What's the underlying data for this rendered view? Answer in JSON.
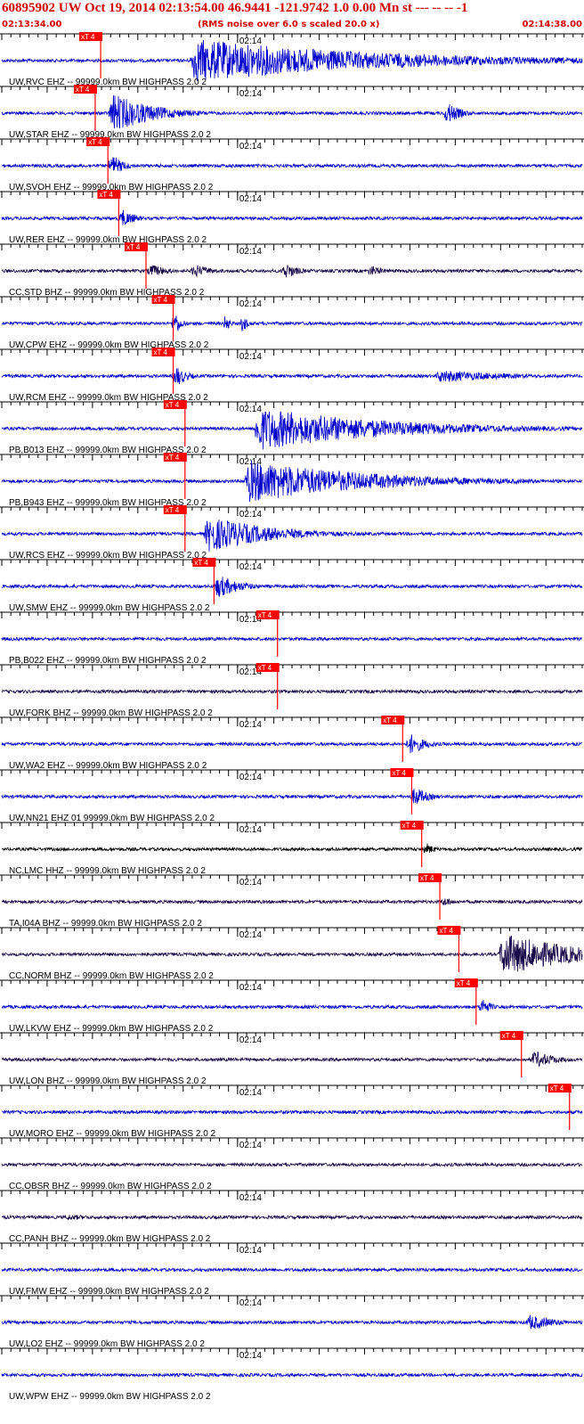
{
  "header": {
    "title": "60895902 UW Oct 19, 2014 02:13:54.00   46.9441 -121.9742  1.0 0.00 Mn st --- -- --  -1",
    "start_time": "02:13:34.00",
    "note": "(RMS noise over 6.0 s scaled 20.0 x)",
    "end_time": "02:14:38.00"
  },
  "colors": {
    "header_text": "#d40000",
    "trace_blue": "#0000cc",
    "trace_dark": "#1a0a4a",
    "trace_black": "#000000",
    "pick": "#ff0000",
    "axis": "#000000"
  },
  "chart_data": {
    "type": "seismogram",
    "time_range": [
      "02:13:34.00",
      "02:14:38.00"
    ],
    "minute_label": "02:14",
    "pick_label": "xT 4",
    "traces": [
      {
        "label": "UW,RVC EHZ -- 99999.0km BW  HIGHPASS  2.0  2",
        "color": "blue",
        "pick_s": 10.9,
        "events": [
          {
            "t": 21.0,
            "amp": 1.0,
            "dur": 20.0
          }
        ]
      },
      {
        "label": "UW,STAR EHZ -- 99999.0km BW  HIGHPASS  2.0  2",
        "color": "blue",
        "pick_s": 10.3,
        "events": [
          {
            "t": 12.0,
            "amp": 0.95,
            "dur": 4.5
          },
          {
            "t": 48.9,
            "amp": 0.6,
            "dur": 1.5
          }
        ]
      },
      {
        "label": "UW,SVOH EHZ -- 99999.0km BW  HIGHPASS  2.0  2",
        "color": "blue",
        "pick_s": 11.7,
        "events": [
          {
            "t": 11.9,
            "amp": 0.6,
            "dur": 1.4
          }
        ]
      },
      {
        "label": "UW,RER EHZ -- 99999.0km BW  HIGHPASS  2.0  2",
        "color": "blue",
        "pick_s": 12.9,
        "events": [
          {
            "t": 13.0,
            "amp": 0.5,
            "dur": 1.5
          }
        ]
      },
      {
        "label": "CC,STD BHZ -- 99999.0km BW  HIGHPASS  2.0  2",
        "color": "dark",
        "pick_s": 15.9,
        "events": [
          {
            "t": 16.2,
            "amp": 0.35,
            "dur": 2.0
          },
          {
            "t": 21.0,
            "amp": 0.35,
            "dur": 2.0
          },
          {
            "t": 31.0,
            "amp": 0.45,
            "dur": 1.5
          },
          {
            "t": 40.5,
            "amp": 0.3,
            "dur": 1.5
          }
        ]
      },
      {
        "label": "UW,CPW EHZ -- 99999.0km BW  HIGHPASS  2.0  2",
        "color": "blue",
        "pick_s": 18.9,
        "events": [
          {
            "t": 18.9,
            "amp": 0.75,
            "dur": 0.7
          },
          {
            "t": 24.6,
            "amp": 0.7,
            "dur": 0.4
          },
          {
            "t": 26.5,
            "amp": 0.7,
            "dur": 0.4
          }
        ]
      },
      {
        "label": "UW,RCM EHZ -- 99999.0km BW  HIGHPASS  2.0  2",
        "color": "blue",
        "pick_s": 18.9,
        "events": [
          {
            "t": 19.0,
            "amp": 0.6,
            "dur": 1.2
          },
          {
            "t": 48.0,
            "amp": 0.3,
            "dur": 8.0
          }
        ]
      },
      {
        "label": "PB,B013 EHZ -- 99999.0km BW  HIGHPASS  2.0  2",
        "color": "blue",
        "pick_s": 20.2,
        "events": [
          {
            "t": 28.0,
            "amp": 1.0,
            "dur": 14.0
          }
        ]
      },
      {
        "label": "PB,B943 EHZ -- 99999.0km BW  HIGHPASS  2.0  2",
        "color": "blue",
        "pick_s": 20.2,
        "events": [
          {
            "t": 27.0,
            "amp": 1.0,
            "dur": 13.0
          }
        ]
      },
      {
        "label": "UW,RCS EHZ -- 99999.0km BW  HIGHPASS  2.0  2",
        "color": "blue",
        "pick_s": 20.2,
        "events": [
          {
            "t": 22.5,
            "amp": 0.85,
            "dur": 7.0
          }
        ]
      },
      {
        "label": "UW,SMW EHZ -- 99999.0km BW  HIGHPASS  2.0  2",
        "color": "blue",
        "pick_s": 23.4,
        "events": [
          {
            "t": 23.6,
            "amp": 0.6,
            "dur": 2.5
          }
        ]
      },
      {
        "label": "PB,B022 EHZ -- 99999.0km BW  HIGHPASS  2.0  2",
        "color": "blue",
        "pick_s": 30.4,
        "events": []
      },
      {
        "label": "UW,FORK BHZ -- 99999.0km BW  HIGHPASS  2.0  2",
        "color": "dark",
        "pick_s": 30.4,
        "events": []
      },
      {
        "label": "UW,WA2 EHZ -- 99999.0km BW  HIGHPASS  2.0  2",
        "color": "blue",
        "pick_s": 44.2,
        "events": [
          {
            "t": 44.8,
            "amp": 0.55,
            "dur": 1.8
          }
        ]
      },
      {
        "label": "UW,NN21 EHZ 01 99999.0km BW  HIGHPASS  2.0  2",
        "color": "blue",
        "pick_s": 45.2,
        "events": [
          {
            "t": 45.3,
            "amp": 0.55,
            "dur": 1.5
          }
        ]
      },
      {
        "label": "NC,LMC HHZ -- 99999.0km BW  HIGHPASS  2.0  2",
        "color": "black",
        "pick_s": 46.3,
        "events": [
          {
            "t": 46.6,
            "amp": 0.35,
            "dur": 1.0
          }
        ]
      },
      {
        "label": "TA,I04A BHZ -- 99999.0km BW  HIGHPASS  2.0  2",
        "color": "dark",
        "pick_s": 48.3,
        "events": [
          {
            "t": 48.6,
            "amp": 0.3,
            "dur": 1.0
          }
        ]
      },
      {
        "label": "CC,NORM BHZ -- 99999.0km BW  HIGHPASS  2.0  2",
        "color": "dark",
        "pick_s": 50.4,
        "events": [
          {
            "t": 55.0,
            "amp": 1.0,
            "dur": 8.0
          }
        ]
      },
      {
        "label": "UW,LKVW EHZ -- 99999.0km BW  HIGHPASS  2.0  2",
        "color": "blue",
        "pick_s": 52.3,
        "events": [
          {
            "t": 52.8,
            "amp": 0.55,
            "dur": 0.9
          }
        ]
      },
      {
        "label": "UW,LON BHZ -- 99999.0km BW  HIGHPASS  2.0  2",
        "color": "dark",
        "pick_s": 57.3,
        "events": [
          {
            "t": 58.5,
            "amp": 0.45,
            "dur": 2.5
          }
        ]
      },
      {
        "label": "UW,MORO EHZ -- 99999.0km BW  HIGHPASS  2.0  2",
        "color": "blue",
        "pick_s": 62.6,
        "events": []
      },
      {
        "label": "CC,OBSR BHZ -- 99999.0km BW  HIGHPASS  2.0  2",
        "color": "dark",
        "pick_s": null,
        "events": []
      },
      {
        "label": "CC,PANH BHZ -- 99999.0km BW  HIGHPASS  2.0  2",
        "color": "dark",
        "pick_s": null,
        "events": [
          {
            "t": 7.0,
            "amp": 0.15,
            "dur": 4.0
          }
        ]
      },
      {
        "label": "UW,FMW EHZ -- 99999.0km BW  HIGHPASS  2.0  2",
        "color": "blue",
        "pick_s": null,
        "events": []
      },
      {
        "label": "UW,LO2 EHZ -- 99999.0km BW  HIGHPASS  2.0  2",
        "color": "blue",
        "pick_s": null,
        "events": [
          {
            "t": 58.0,
            "amp": 0.4,
            "dur": 3.0
          }
        ]
      },
      {
        "label": "UW,WPW EHZ -- 99999.0km BW  HIGHPASS  2.0  2",
        "color": "blue",
        "pick_s": null,
        "events": []
      }
    ]
  }
}
